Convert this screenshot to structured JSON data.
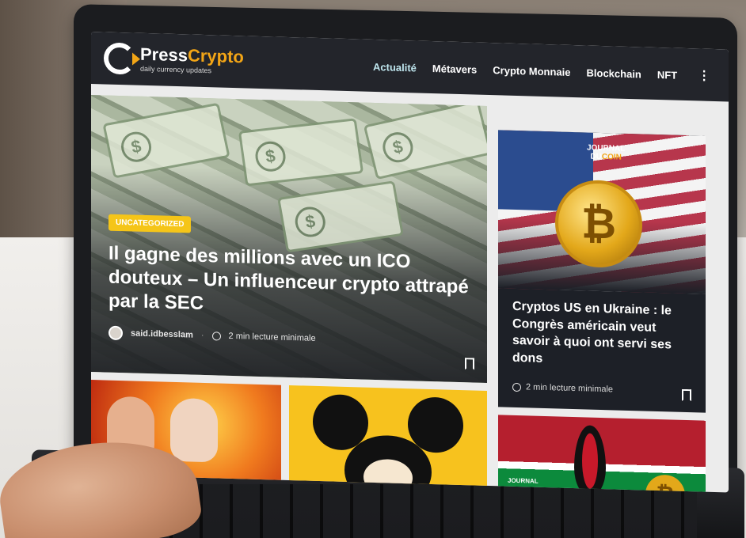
{
  "site": {
    "logo_name_prefix": "Press",
    "logo_name_accent": "Crypto",
    "logo_tagline": "daily currency updates"
  },
  "nav": {
    "items": [
      {
        "label": "Actualité",
        "active": true
      },
      {
        "label": "Métavers",
        "active": false
      },
      {
        "label": "Crypto Monnaie",
        "active": false
      },
      {
        "label": "Blockchain",
        "active": false
      },
      {
        "label": "NFT",
        "active": false
      }
    ],
    "more_icon": "more-vertical-icon"
  },
  "hero": {
    "badge": "Uncategorized",
    "title": "Il gagne des millions avec un ICO douteux – Un influenceur crypto attrapé par la SEC",
    "author": "said.idbesslam",
    "read_time": "2 min lecture minimale"
  },
  "side_article": {
    "brand_top": "JOURNAL",
    "brand_bottom_prefix": "DU",
    "brand_bottom_accent": "COIN",
    "coin_symbol": "₿",
    "title": "Cryptos US en Ukraine : le Congrès américain veut savoir à quoi ont servi ses dons",
    "read_time": "2 min lecture minimale"
  },
  "thumb_3": {
    "brand": "JOURNAL",
    "coin_symbol": "₿"
  },
  "colors": {
    "topbar": "#23252b",
    "accent": "#f2a516",
    "badge": "#f5c518",
    "active_nav": "#bfe6ee"
  }
}
